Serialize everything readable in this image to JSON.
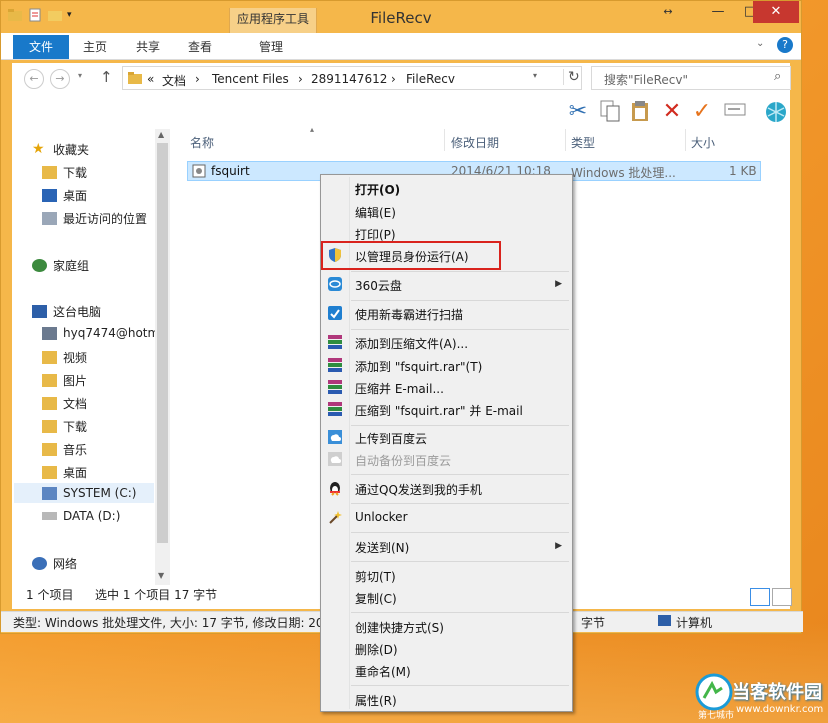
{
  "window": {
    "title": "FileRecv",
    "context_tab": "应用程序工具"
  },
  "ribbon": {
    "tabs": [
      "文件",
      "主页",
      "共享",
      "查看",
      "管理"
    ]
  },
  "address": {
    "crumbs": [
      "«",
      "文档",
      "›",
      "Tencent Files",
      "›",
      "2891147612",
      "›",
      "FileRecv"
    ],
    "search_placeholder": "搜索\"FileRecv\""
  },
  "toolbar": {
    "icons": [
      "scissors-icon",
      "copy-icon",
      "paste-icon",
      "delete-icon",
      "check-icon",
      "rename-icon",
      "shell-icon"
    ]
  },
  "nav": {
    "favorites": {
      "title": "收藏夹",
      "items": [
        "下载",
        "桌面",
        "最近访问的位置"
      ]
    },
    "homegroup": "家庭组",
    "thispc": {
      "title": "这台电脑",
      "items": [
        "hyq7474@hotm",
        "视频",
        "图片",
        "文档",
        "下载",
        "音乐",
        "桌面",
        "SYSTEM (C:)",
        "DATA (D:)"
      ]
    },
    "network": "网络"
  },
  "columns": [
    "名称",
    "修改日期",
    "类型",
    "大小"
  ],
  "file": {
    "name": "fsquirt",
    "date": "2014/6/21 10:18",
    "type": "Windows 批处理...",
    "size": "1 KB"
  },
  "status": {
    "count": "1 个项目",
    "selected": "选中 1 个项目  17 字节"
  },
  "details": {
    "left": "类型: Windows 批处理文件, 大小: 17 字节, 修改日期: 201",
    "mid": "字节",
    "right": "计算机"
  },
  "menu": {
    "items": [
      "打开(O)",
      "编辑(E)",
      "打印(P)",
      "以管理员身份运行(A)",
      "360云盘",
      "使用新毒霸进行扫描",
      "添加到压缩文件(A)...",
      "添加到 \"fsquirt.rar\"(T)",
      "压缩并 E-mail...",
      "压缩到 \"fsquirt.rar\" 并 E-mail",
      "上传到百度云",
      "自动备份到百度云",
      "通过QQ发送到我的手机",
      "Unlocker",
      "发送到(N)",
      "剪切(T)",
      "复制(C)",
      "创建快捷方式(S)",
      "删除(D)",
      "重命名(M)",
      "属性(R)"
    ]
  },
  "watermark": {
    "name": "当客软件园",
    "url": "www.downkr.com",
    "corner": "第七城市"
  },
  "colors": {
    "accent": "#1979ca",
    "window_frame": "#f5b74a",
    "highlight_border": "#d9231d",
    "selection": "#cce8ff"
  }
}
